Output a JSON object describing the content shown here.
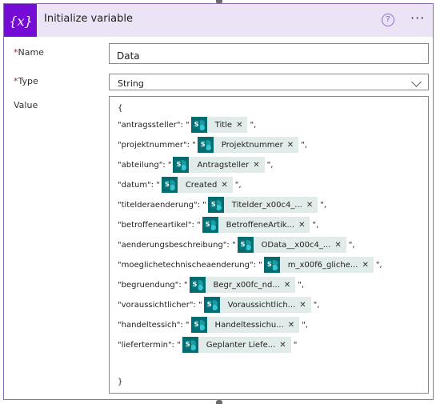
{
  "header": {
    "icon_text": "{x}",
    "title": "Initialize variable",
    "help": "?",
    "more": "···"
  },
  "fields": {
    "name_label": "Name",
    "name_value": "Data",
    "type_label": "Type",
    "type_value": "String",
    "value_label": "Value",
    "required_mark": "*"
  },
  "value": {
    "open": "{",
    "close": "}",
    "lines": [
      {
        "key": "\"antragssteller\": \"",
        "token": "Title",
        "suffix": "\","
      },
      {
        "key": "\"projektnummer\": \"",
        "token": "Projektnummer",
        "suffix": "\","
      },
      {
        "key": "\"abteilung\": \"",
        "token": "Antragsteller",
        "suffix": "\","
      },
      {
        "key": "\"datum\": \"",
        "token": "Created",
        "suffix": "\","
      },
      {
        "key": "\"titelderaenderung\": \"",
        "token": "Titelder_x00c4_...",
        "suffix": "\","
      },
      {
        "key": "\"betroffeneartikel\": \"",
        "token": "BetroffeneArtik...",
        "suffix": "\","
      },
      {
        "key": "\"aenderungsbeschreibung\": \"",
        "token": "OData__x00c4_...",
        "suffix": "\","
      },
      {
        "key": "\"moeglichetechnischeaenderung\": \"",
        "token": "m_x00f6_gliche...",
        "suffix": "\","
      },
      {
        "key": "\"begruendung\": \"",
        "token": "Begr_x00fc_nd...",
        "suffix": "\","
      },
      {
        "key": "\"voraussichtlicher\": \"",
        "token": "Voraussichtlich...",
        "suffix": "\","
      },
      {
        "key": "\"handeltessich\": \"",
        "token": "Handeltessichu...",
        "suffix": "\","
      },
      {
        "key": "\"liefertermin\": \"",
        "token": "Geplanter Liefe...",
        "suffix": "\""
      }
    ]
  },
  "icons": {
    "token_icon": "sharepoint-icon",
    "remove_icon": "close-icon"
  }
}
